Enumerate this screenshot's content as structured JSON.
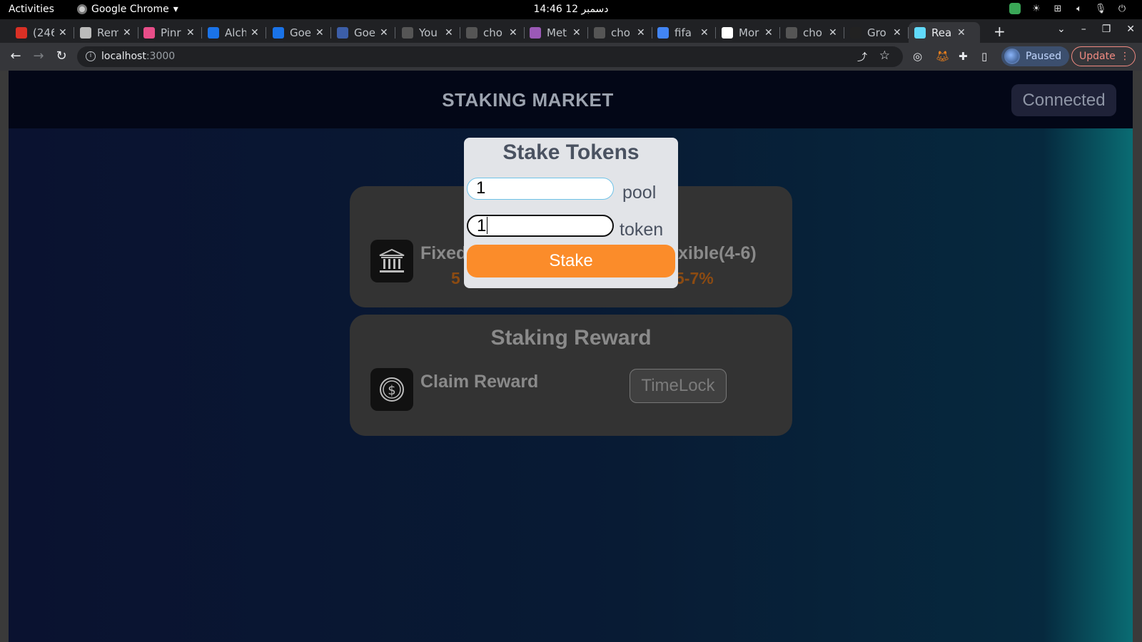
{
  "system_bar": {
    "activities": "Activities",
    "app_name": "Google Chrome",
    "clock": "14:46  12 دسمبر"
  },
  "tabs": [
    {
      "label": "(246",
      "favicon_color": "#d93025"
    },
    {
      "label": "Rem",
      "favicon_color": "#bbbbbb"
    },
    {
      "label": "Pinr",
      "favicon_color": "#e84e89"
    },
    {
      "label": "Alch",
      "favicon_color": "#1a73e8"
    },
    {
      "label": "Goe",
      "favicon_color": "#1a73e8"
    },
    {
      "label": "Goe",
      "favicon_color": "#3c5ea8"
    },
    {
      "label": "You",
      "favicon_color": "#555555"
    },
    {
      "label": "cho",
      "favicon_color": "#555555"
    },
    {
      "label": "Met",
      "favicon_color": "#9b59b6"
    },
    {
      "label": "cho",
      "favicon_color": "#555555"
    },
    {
      "label": "fifa",
      "favicon_color": "#4285f4"
    },
    {
      "label": "Mor",
      "favicon_color": "#ffffff"
    },
    {
      "label": "cho",
      "favicon_color": "#555555"
    },
    {
      "label": "Gro",
      "favicon_color": "#222222"
    },
    {
      "label": "Rea",
      "favicon_color": "#61dafb"
    }
  ],
  "browser": {
    "url_host": "localhost",
    "url_port": ":3000",
    "profile_status": "Paused",
    "update_label": "Update"
  },
  "app": {
    "title": "STAKING MARKET",
    "wallet_status": "Connected",
    "staking_card": {
      "fixed_label": "Fixed",
      "fixed_rate": "5",
      "flexible_label": "xible(4-6)",
      "flexible_rate": "5-7%"
    },
    "reward_card": {
      "title": "Staking Reward",
      "claim_label": "Claim Reward",
      "timelock_label": "TimeLock"
    }
  },
  "modal": {
    "title": "Stake Tokens",
    "pool_value": "1",
    "pool_suffix": "pool",
    "token_value": "1",
    "token_suffix": "token",
    "stake_label": "Stake"
  },
  "colors": {
    "accent_orange": "#fb8c2a",
    "rate_color": "#8c4b12",
    "page_bg": "#0a1230"
  }
}
